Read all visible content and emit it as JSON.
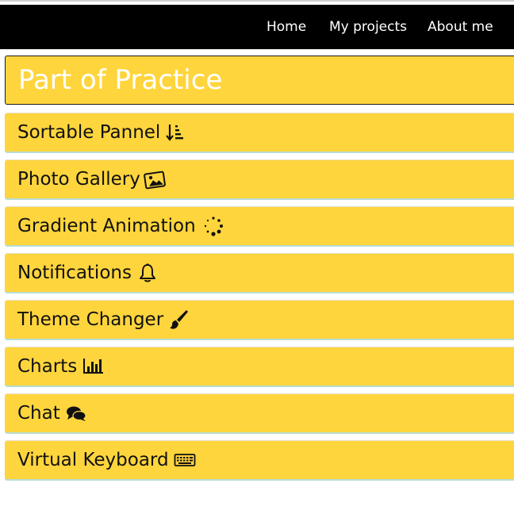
{
  "nav": {
    "home": "Home",
    "projects": "My projects",
    "about": "About me"
  },
  "page": {
    "title": "Part of Practice"
  },
  "items": [
    {
      "label": "Sortable Pannel",
      "icon": "sort-amount-icon"
    },
    {
      "label": "Photo Gallery",
      "icon": "image-icon"
    },
    {
      "label": "Gradient Animation",
      "icon": "spinner-icon"
    },
    {
      "label": "Notifications",
      "icon": "bell-icon"
    },
    {
      "label": "Theme Changer",
      "icon": "paintbrush-icon"
    },
    {
      "label": "Charts",
      "icon": "bar-chart-icon"
    },
    {
      "label": "Chat",
      "icon": "comments-icon"
    },
    {
      "label": "Virtual Keyboard",
      "icon": "keyboard-icon"
    }
  ],
  "colors": {
    "accent": "#ffd53d",
    "navbar": "#000000"
  }
}
